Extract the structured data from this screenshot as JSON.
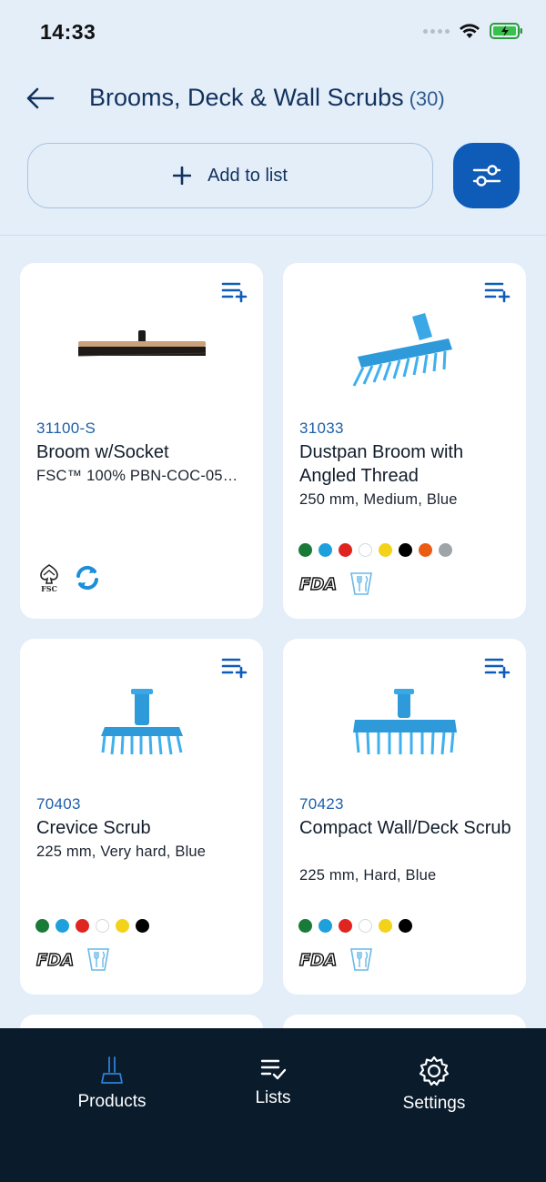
{
  "status_bar": {
    "time": "14:33"
  },
  "header": {
    "title": "Brooms, Deck & Wall Scrubs",
    "count": "(30)"
  },
  "actions": {
    "add_to_list": "Add to list"
  },
  "products": [
    {
      "code": "31100-S",
      "name": "Broom w/Socket",
      "description": "FSC™ 100% PBN-COC-05…",
      "image": "black-broom-head",
      "swatches": [],
      "badges": [
        "fsc-badge",
        "recycle-badge"
      ]
    },
    {
      "code": "31033",
      "name": "Dustpan Broom with Angled Thread",
      "description": "250 mm, Medium, Blue",
      "image": "blue-angled-broom",
      "swatches": [
        "#1a7a37",
        "#1da0dc",
        "#e0241f",
        "#ffffff",
        "#f3d21a",
        "#000000",
        "#ea5c14",
        "#9ea4a8"
      ],
      "badges": [
        "fda-badge",
        "food-safe-badge"
      ]
    },
    {
      "code": "70403",
      "name": "Crevice Scrub",
      "description": "225 mm, Very hard, Blue",
      "image": "blue-crevice-scrub",
      "swatches": [
        "#1a7a37",
        "#1da0dc",
        "#e0241f",
        "#ffffff",
        "#f3d21a",
        "#000000"
      ],
      "badges": [
        "fda-badge",
        "food-safe-badge"
      ]
    },
    {
      "code": "70423",
      "name": "Compact Wall/Deck Scrub",
      "description": "225 mm, Hard, Blue",
      "image": "blue-deck-scrub",
      "swatches": [
        "#1a7a37",
        "#1da0dc",
        "#e0241f",
        "#ffffff",
        "#f3d21a",
        "#000000"
      ],
      "badges": [
        "fda-badge",
        "food-safe-badge"
      ]
    }
  ],
  "tabs": [
    {
      "label": "Products",
      "icon": "broom-icon",
      "active": true
    },
    {
      "label": "Lists",
      "icon": "list-check-icon",
      "active": false
    },
    {
      "label": "Settings",
      "icon": "gear-icon",
      "active": false
    }
  ],
  "colors": {
    "accent": "#0f5bb8",
    "background": "#e3eef9",
    "tabbar": "#0a1b2c",
    "code": "#1d5fab"
  }
}
